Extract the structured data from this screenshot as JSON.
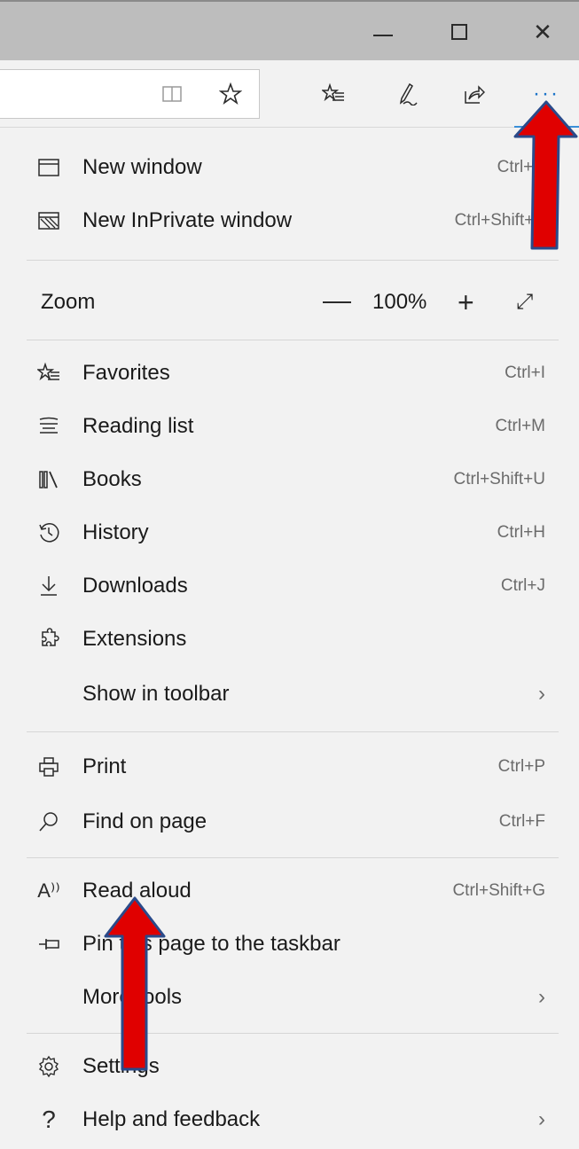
{
  "window_controls": {
    "minimize_icon": "minimize-icon",
    "maximize_icon": "maximize-icon",
    "close_icon": "close-icon",
    "close_glyph": "✕"
  },
  "toolbar": {
    "reading_view_icon": "reading-view-icon",
    "add_favorite_icon": "star-icon",
    "favorites_icon": "favorites-icon",
    "notes_icon": "pen-icon",
    "share_icon": "share-icon",
    "more_glyph": "···",
    "accent_color": "#1a73c8"
  },
  "menu": {
    "new_window": {
      "label": "New window",
      "shortcut": "Ctrl+N"
    },
    "new_inprivate": {
      "label": "New InPrivate window",
      "shortcut": "Ctrl+Shift+P"
    },
    "zoom": {
      "label": "Zoom",
      "value": "100%",
      "plus": "+",
      "fullscreen": "⤢"
    },
    "favorites": {
      "label": "Favorites",
      "shortcut": "Ctrl+I"
    },
    "reading_list": {
      "label": "Reading list",
      "shortcut": "Ctrl+M"
    },
    "books": {
      "label": "Books",
      "shortcut": "Ctrl+Shift+U"
    },
    "history": {
      "label": "History",
      "shortcut": "Ctrl+H"
    },
    "downloads": {
      "label": "Downloads",
      "shortcut": "Ctrl+J"
    },
    "extensions": {
      "label": "Extensions"
    },
    "show_in_toolbar": {
      "label": "Show in toolbar",
      "chevron": "›"
    },
    "print": {
      "label": "Print",
      "shortcut": "Ctrl+P"
    },
    "find_on_page": {
      "label": "Find on page",
      "shortcut": "Ctrl+F"
    },
    "read_aloud": {
      "label": "Read aloud",
      "shortcut": "Ctrl+Shift+G",
      "icon_text": "A⁾⁾"
    },
    "pin_taskbar": {
      "label": "Pin this page to the taskbar"
    },
    "more_tools": {
      "label": "More tools",
      "chevron": "›"
    },
    "settings": {
      "label": "Settings"
    },
    "help": {
      "label": "Help and feedback",
      "icon_text": "?",
      "chevron": "›"
    }
  },
  "annotations": {
    "arrow_color": "#e00000",
    "arrow_outline": "#2a4a8a"
  }
}
